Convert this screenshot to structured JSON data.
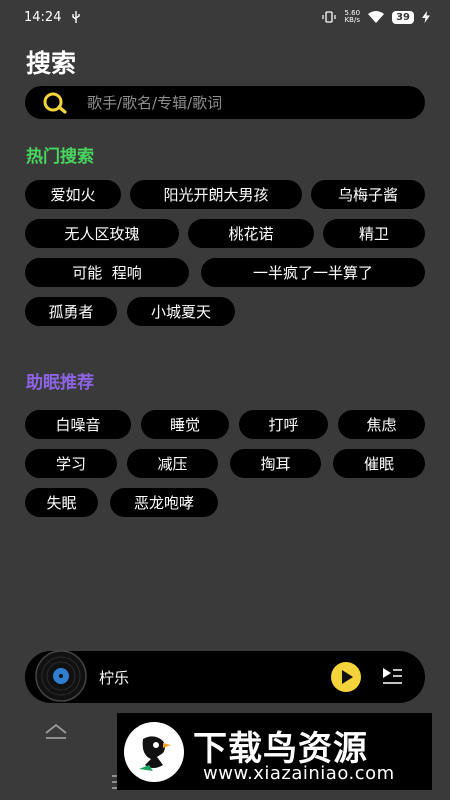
{
  "status_bar": {
    "time": "14:24",
    "usb_icon": "usb-icon",
    "net_speed_value": "5.60",
    "net_speed_unit": "KB/s",
    "battery": "39"
  },
  "page": {
    "title": "搜索"
  },
  "search": {
    "placeholder": "歌手/歌名/专辑/歌词",
    "icon": "search-icon"
  },
  "hot_search": {
    "title": "热门搜索",
    "title_color": "#47d65e",
    "tags": [
      "爱如火",
      "阳光开朗大男孩",
      "乌梅子酱",
      "无人区玫瑰",
      "桃花诺",
      "精卫",
      "可能  程响",
      "一半疯了一半算了",
      "孤勇者",
      "小城夏天"
    ]
  },
  "sleep_aid": {
    "title": "助眠推荐",
    "title_color": "#8d64e6",
    "tags": [
      "白噪音",
      "睡觉",
      "打呼",
      "焦虑",
      "学习",
      "减压",
      "掏耳",
      "催眠",
      "失眠",
      "恶龙咆哮"
    ]
  },
  "player": {
    "title": "柠乐",
    "accent": "#f5d33b",
    "icons": [
      "vinyl-disc-icon",
      "play-icon",
      "playlist-icon"
    ]
  },
  "bottom_nav": {
    "icons": [
      "chevron-up-icon",
      "menu-icon"
    ]
  },
  "watermark": {
    "title": "下载鸟资源",
    "url": "www.xiazainiao.com"
  }
}
